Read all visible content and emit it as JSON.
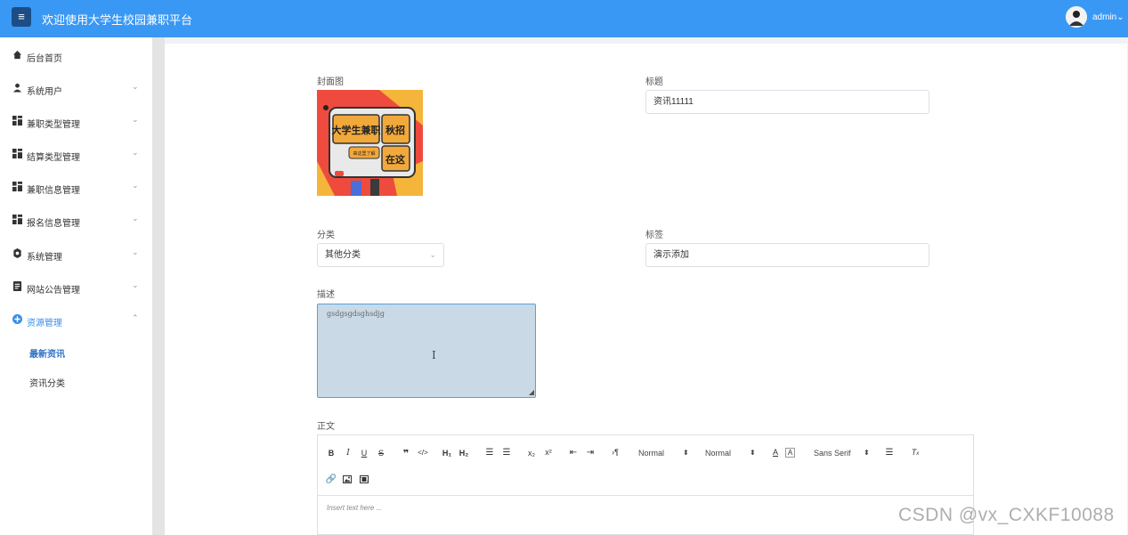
{
  "header": {
    "title": "欢迎使用大学生校园兼职平台",
    "user": "admin",
    "menu_icon": "hamburger-icon",
    "color": "#3a98f5"
  },
  "sidebar": {
    "items": [
      {
        "label": "后台首页",
        "icon": "home-icon"
      },
      {
        "label": "系统用户",
        "icon": "user-icon"
      },
      {
        "label": "兼职类型管理",
        "icon": "grid-icon"
      },
      {
        "label": "结算类型管理",
        "icon": "grid-icon"
      },
      {
        "label": "兼职信息管理",
        "icon": "grid-icon"
      },
      {
        "label": "报名信息管理",
        "icon": "grid-icon"
      },
      {
        "label": "系统管理",
        "icon": "gear-icon"
      },
      {
        "label": "网站公告管理",
        "icon": "document-icon"
      },
      {
        "label": "资源管理",
        "icon": "plus-circle-icon"
      }
    ],
    "sub_items": [
      "最新资讯",
      "资讯分类"
    ]
  },
  "form": {
    "cover_label": "封面图",
    "title_label": "标题",
    "title_value": "资讯11111",
    "category_label": "分类",
    "category_value": "其他分类",
    "tags_label": "标签",
    "tags_value": "演示添加",
    "desc_label": "描述",
    "desc_value": "gsdgsgdsghsdjg",
    "body_label": "正文"
  },
  "cover_image": {
    "text_main": "大学生兼职",
    "text_side1": "秋招",
    "text_side2": "在这",
    "text_sub": "来这里了解"
  },
  "editor": {
    "header_select": "Normal",
    "size_select": "Normal",
    "font_select": "Sans Serif",
    "placeholder": "Insert text here ..."
  },
  "watermark": "CSDN @vx_CXKF10088"
}
